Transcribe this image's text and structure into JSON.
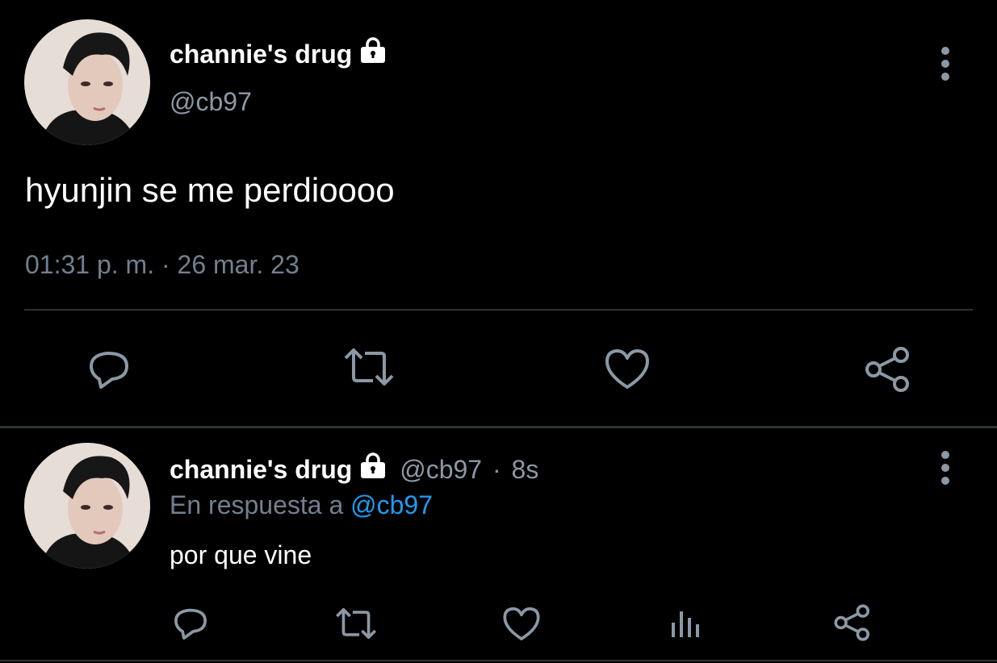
{
  "main_tweet": {
    "display_name": "channie's drug",
    "handle": "@cb97",
    "text": "hyunjin se me perdioooo",
    "timestamp": "01:31 p. m. · 26 mar. 23",
    "avatar_icon": "user-avatar",
    "actions": [
      "reply-icon",
      "retweet-icon",
      "like-icon",
      "share-icon"
    ]
  },
  "reply_tweet": {
    "display_name": "channie's drug",
    "handle": "@cb97",
    "separator": "·",
    "time_ago": "8s",
    "reply_prefix": "En respuesta a",
    "reply_mention": "@cb97",
    "text": "por que vine",
    "avatar_icon": "user-avatar",
    "actions": [
      "reply-icon",
      "retweet-icon",
      "like-icon",
      "analytics-icon",
      "share-icon"
    ]
  },
  "colors": {
    "background": "#000000",
    "primary_text": "#ffffff",
    "secondary_text": "#8b98a5",
    "accent": "#1d9bf0",
    "divider": "#2f3336"
  }
}
